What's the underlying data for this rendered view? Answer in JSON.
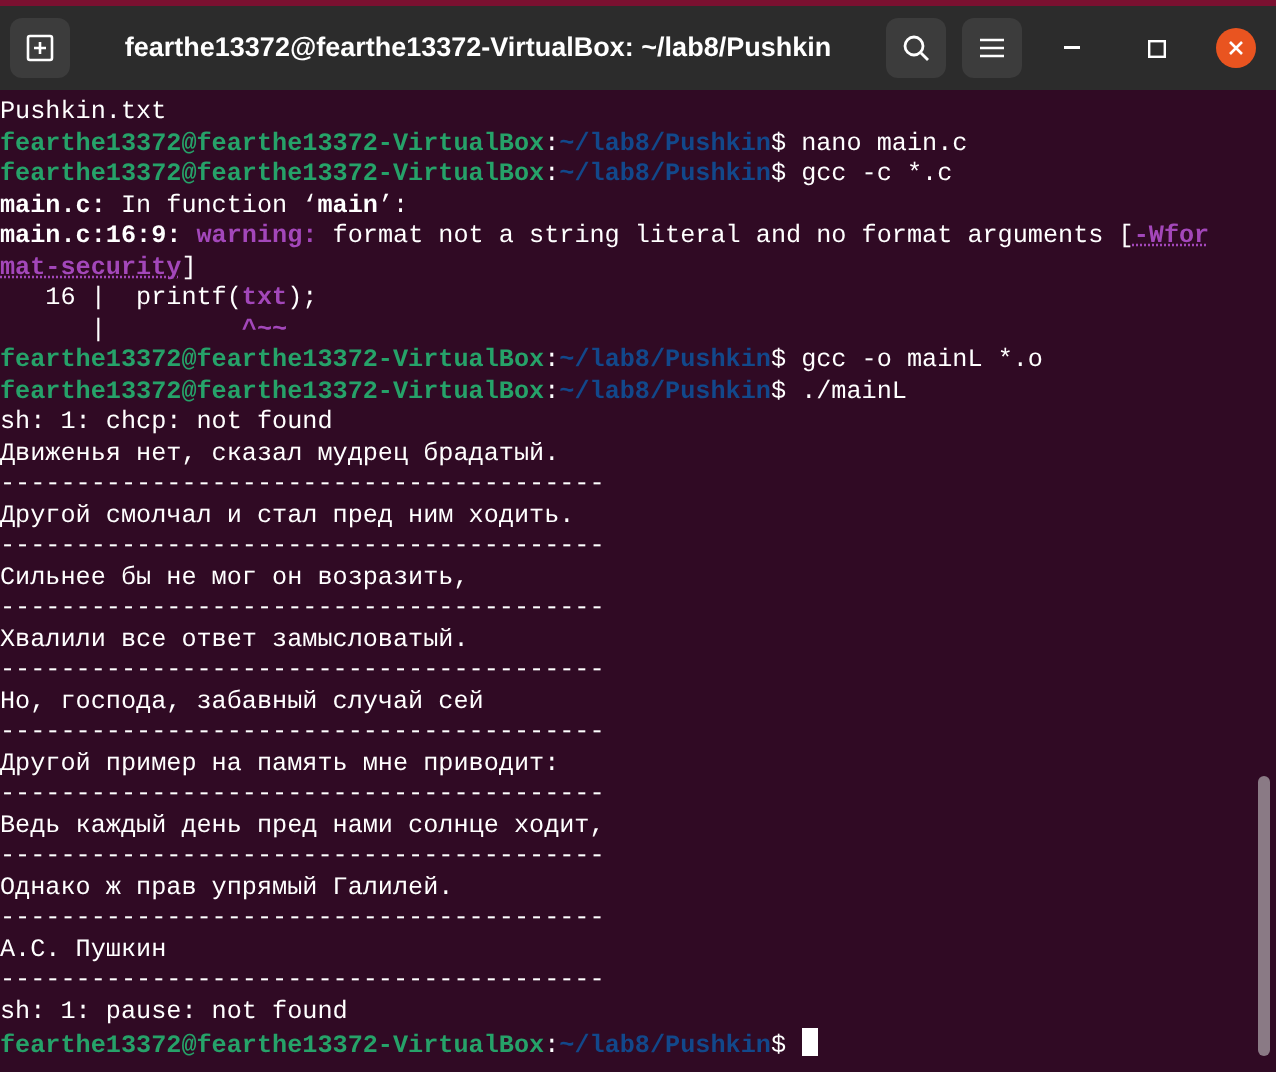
{
  "window": {
    "title": "fearthe13372@fearthe13372-VirtualBox: ~/lab8/Pushkin"
  },
  "terminal": {
    "lines": [
      {
        "segments": [
          {
            "kind": "plain",
            "text": "Pushkin.txt"
          }
        ]
      },
      {
        "segments": [
          {
            "kind": "user",
            "text": "fearthe13372@fearthe13372-VirtualBox"
          },
          {
            "kind": "plain",
            "text": ":"
          },
          {
            "kind": "path",
            "text": "~/lab8/Pushkin"
          },
          {
            "kind": "plain",
            "text": "$ nano main.c"
          }
        ]
      },
      {
        "segments": [
          {
            "kind": "user",
            "text": "fearthe13372@fearthe13372-VirtualBox"
          },
          {
            "kind": "plain",
            "text": ":"
          },
          {
            "kind": "path",
            "text": "~/lab8/Pushkin"
          },
          {
            "kind": "plain",
            "text": "$ gcc -c *.c"
          }
        ]
      },
      {
        "segments": [
          {
            "kind": "bold",
            "text": "main.c:"
          },
          {
            "kind": "plain",
            "text": " In function ‘"
          },
          {
            "kind": "bold",
            "text": "main"
          },
          {
            "kind": "plain",
            "text": "’:"
          }
        ]
      },
      {
        "segments": [
          {
            "kind": "bold",
            "text": "main.c:16:9: "
          },
          {
            "kind": "warning",
            "text": "warning:"
          },
          {
            "kind": "plain",
            "text": " format not a string literal and no format arguments ["
          },
          {
            "kind": "link",
            "text": "-Wfor"
          }
        ]
      },
      {
        "segments": [
          {
            "kind": "link",
            "text": "mat-security"
          },
          {
            "kind": "plain",
            "text": "]"
          }
        ]
      },
      {
        "segments": [
          {
            "kind": "plain",
            "text": "   16 |  printf("
          },
          {
            "kind": "accent",
            "text": "txt"
          },
          {
            "kind": "plain",
            "text": ");"
          }
        ]
      },
      {
        "segments": [
          {
            "kind": "plain",
            "text": "      |         "
          },
          {
            "kind": "accent",
            "text": "^~~"
          }
        ]
      },
      {
        "segments": [
          {
            "kind": "user",
            "text": "fearthe13372@fearthe13372-VirtualBox"
          },
          {
            "kind": "plain",
            "text": ":"
          },
          {
            "kind": "path",
            "text": "~/lab8/Pushkin"
          },
          {
            "kind": "plain",
            "text": "$ gcc -o mainL *.o"
          }
        ]
      },
      {
        "segments": [
          {
            "kind": "user",
            "text": "fearthe13372@fearthe13372-VirtualBox"
          },
          {
            "kind": "plain",
            "text": ":"
          },
          {
            "kind": "path",
            "text": "~/lab8/Pushkin"
          },
          {
            "kind": "plain",
            "text": "$ ./mainL"
          }
        ]
      },
      {
        "segments": [
          {
            "kind": "plain",
            "text": "sh: 1: chcp: not found"
          }
        ]
      },
      {
        "segments": [
          {
            "kind": "plain",
            "text": "Движенья нет, сказал мудрец брадатый."
          }
        ]
      },
      {
        "segments": [
          {
            "kind": "plain",
            "text": "----------------------------------------"
          }
        ]
      },
      {
        "segments": [
          {
            "kind": "plain",
            "text": "Другой смолчал и стал пред ним ходить."
          }
        ]
      },
      {
        "segments": [
          {
            "kind": "plain",
            "text": "----------------------------------------"
          }
        ]
      },
      {
        "segments": [
          {
            "kind": "plain",
            "text": "Сильнее бы не мог он возразить,"
          }
        ]
      },
      {
        "segments": [
          {
            "kind": "plain",
            "text": "----------------------------------------"
          }
        ]
      },
      {
        "segments": [
          {
            "kind": "plain",
            "text": "Хвалили все ответ замысловатый."
          }
        ]
      },
      {
        "segments": [
          {
            "kind": "plain",
            "text": "----------------------------------------"
          }
        ]
      },
      {
        "segments": [
          {
            "kind": "plain",
            "text": "Но, господа, забавный случай сей"
          }
        ]
      },
      {
        "segments": [
          {
            "kind": "plain",
            "text": "----------------------------------------"
          }
        ]
      },
      {
        "segments": [
          {
            "kind": "plain",
            "text": "Другой пример на память мне приводит:"
          }
        ]
      },
      {
        "segments": [
          {
            "kind": "plain",
            "text": "----------------------------------------"
          }
        ]
      },
      {
        "segments": [
          {
            "kind": "plain",
            "text": "Ведь каждый день пред нами солнце ходит,"
          }
        ]
      },
      {
        "segments": [
          {
            "kind": "plain",
            "text": "----------------------------------------"
          }
        ]
      },
      {
        "segments": [
          {
            "kind": "plain",
            "text": "Однако ж прав упрямый Галилей."
          }
        ]
      },
      {
        "segments": [
          {
            "kind": "plain",
            "text": "----------------------------------------"
          }
        ]
      },
      {
        "segments": [
          {
            "kind": "plain",
            "text": "А.С. Пушкин"
          }
        ]
      },
      {
        "segments": [
          {
            "kind": "plain",
            "text": "----------------------------------------"
          }
        ]
      },
      {
        "segments": [
          {
            "kind": "plain",
            "text": "sh: 1: pause: not found"
          }
        ]
      },
      {
        "segments": [
          {
            "kind": "user",
            "text": "fearthe13372@fearthe13372-VirtualBox"
          },
          {
            "kind": "plain",
            "text": ":"
          },
          {
            "kind": "path",
            "text": "~/lab8/Pushkin"
          },
          {
            "kind": "plain",
            "text": "$ "
          }
        ],
        "cursor": true
      }
    ]
  }
}
